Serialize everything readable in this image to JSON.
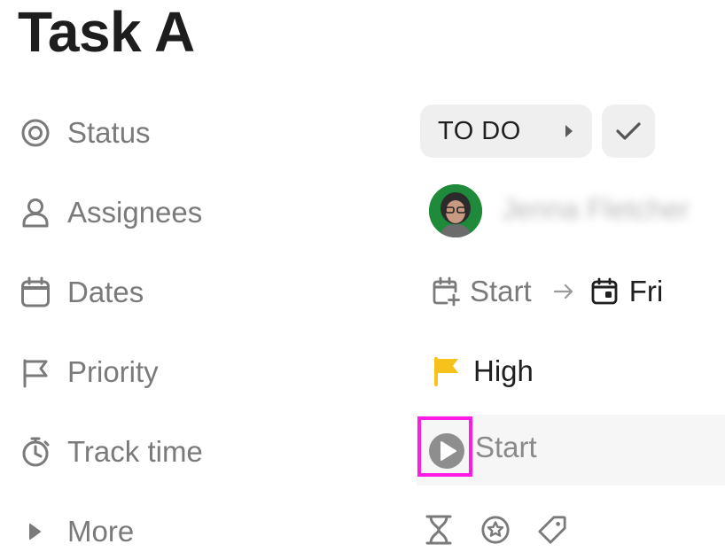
{
  "task": {
    "title": "Task A"
  },
  "fields": {
    "status": {
      "label": "Status",
      "value": "TO DO"
    },
    "assignees": {
      "label": "Assignees",
      "name": "Jenna Fletcher"
    },
    "dates": {
      "label": "Dates",
      "start": "Start",
      "end": "Fri"
    },
    "priority": {
      "label": "Priority",
      "value": "High",
      "color": "#f7c21b"
    },
    "track_time": {
      "label": "Track time",
      "action": "Start"
    },
    "more": {
      "label": "More"
    }
  },
  "colors": {
    "highlight": "#ff1be6",
    "label_gray": "#7a7a7a",
    "pill_bg": "#efefef"
  },
  "icons": [
    "target-icon",
    "person-icon",
    "calendar-icon",
    "flag-icon",
    "stopwatch-icon",
    "caret-right-icon",
    "check-icon",
    "calendar-plus-icon",
    "arrow-right-icon",
    "calendar-day-icon",
    "priority-flag-icon",
    "play-icon",
    "hourglass-icon",
    "star-badge-icon",
    "tag-icon"
  ]
}
